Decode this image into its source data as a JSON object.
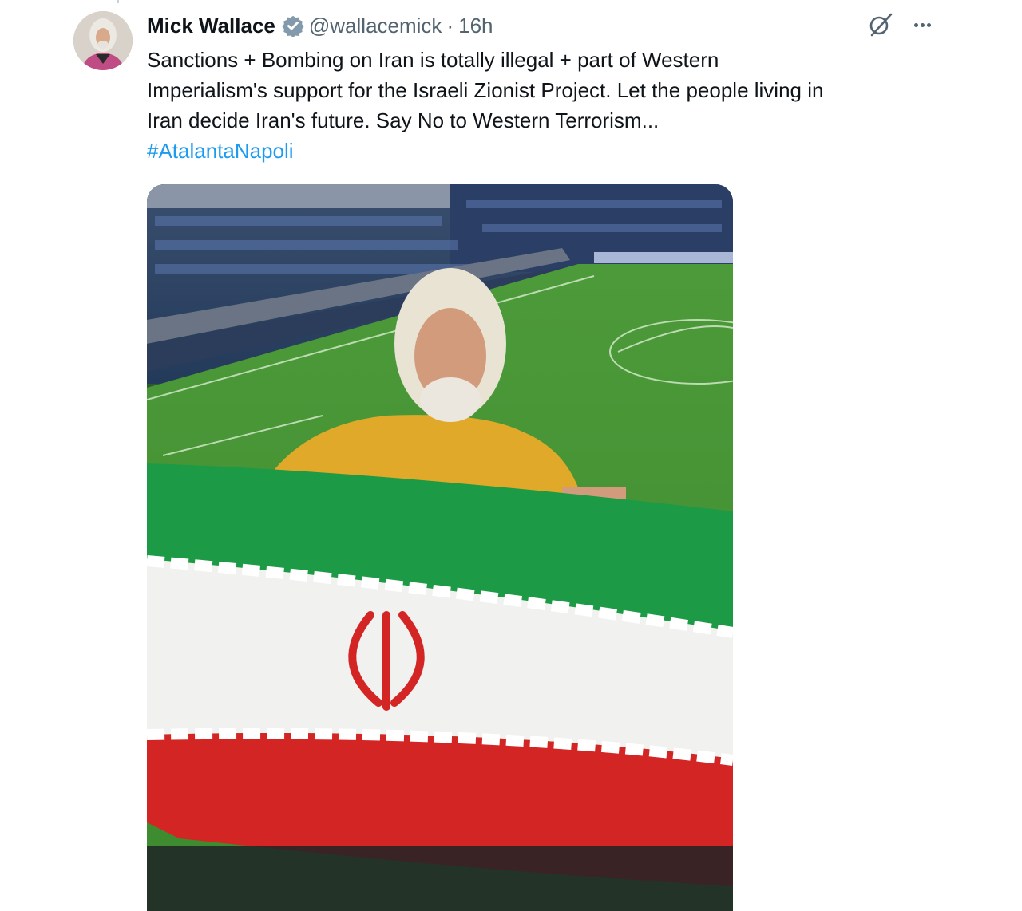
{
  "author": {
    "display_name": "Mick Wallace",
    "handle": "@wallacemick",
    "separator": "·",
    "time": "16h",
    "verified": true
  },
  "tweet": {
    "lines": [
      "Sanctions + Bombing on Iran is totally illegal + part of Western",
      "Imperialism's support for the Israeli Zionist Project. Let the people living in",
      "Iran decide Iran's future. Say No to Western Terrorism..."
    ],
    "hashtag": "#AtalantaNapoli"
  },
  "icons": {
    "avatar": "avatar-photo",
    "verified": "verified-badge-icon",
    "grok": "grok-icon",
    "more": "more-options-icon"
  },
  "colors": {
    "text": "#0f1419",
    "secondary": "#536471",
    "link": "#1d9bf0",
    "verified": "#829aab"
  }
}
